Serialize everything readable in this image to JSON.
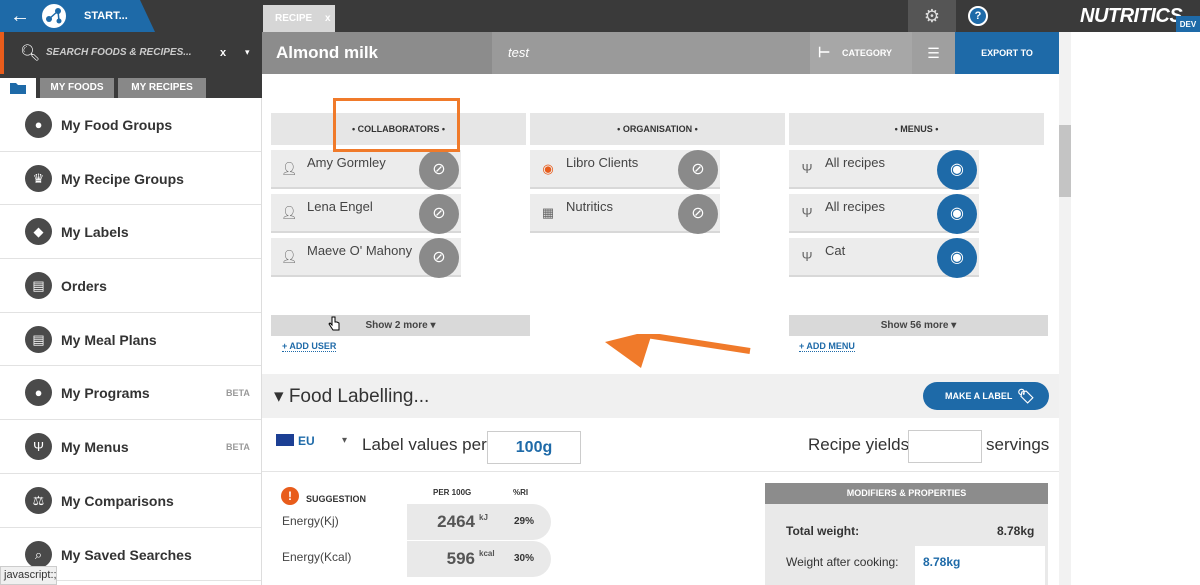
{
  "topbar": {
    "start_label": "START...",
    "tab_label": "RECIPE",
    "tab_close": "x",
    "brand": "NUTRITICS",
    "brand_badge": "DEV",
    "help_label": "?"
  },
  "sidebar": {
    "search_placeholder": "SEARCH FOODS & RECIPES...",
    "search_clear": "x",
    "search_dropdown": "▾",
    "tabs": [
      "MY FOODS",
      "MY RECIPES"
    ],
    "items": [
      {
        "label": "My Food Groups",
        "icon": "apple-icon",
        "badge": ""
      },
      {
        "label": "My Recipe Groups",
        "icon": "chef-hat-icon",
        "badge": ""
      },
      {
        "label": "My Labels",
        "icon": "tag-icon",
        "badge": ""
      },
      {
        "label": "Orders",
        "icon": "document-icon",
        "badge": ""
      },
      {
        "label": "My Meal Plans",
        "icon": "document-icon",
        "badge": ""
      },
      {
        "label": "My Programs",
        "icon": "apple-icon",
        "badge": "BETA"
      },
      {
        "label": "My Menus",
        "icon": "cutlery-icon",
        "badge": "BETA"
      },
      {
        "label": "My Comparisons",
        "icon": "scales-icon",
        "badge": ""
      },
      {
        "label": "My Saved Searches",
        "icon": "search-icon",
        "badge": ""
      }
    ]
  },
  "status_bar": "javascript:;",
  "recipe": {
    "title": "Almond milk",
    "subtitle": "test",
    "category_label": "CATEGORY",
    "export_label": "EXPORT TO"
  },
  "sharing": {
    "collaborators": {
      "header": "COLLABORATORS",
      "rows": [
        "Amy Gormley",
        "Lena Engel",
        "Maeve O' Mahony"
      ],
      "more": "Show 2 more",
      "add": "+ ADD USER"
    },
    "organisation": {
      "header": "ORGANISATION",
      "rows": [
        "Libro Clients",
        "Nutritics"
      ]
    },
    "menus": {
      "header": "MENUS",
      "rows": [
        "All recipes",
        "All recipes",
        "Cat"
      ],
      "more": "Show 56 more",
      "add": "+ ADD MENU"
    }
  },
  "food_labelling": {
    "title": "Food Labelling...",
    "make_label": "MAKE A LABEL",
    "region": "EU",
    "label_values_per": "Label values per",
    "per_value": "100g",
    "recipe_yields": "Recipe yields",
    "servings": "servings",
    "suggestion": "SUGGESTION",
    "col_per100": "PER 100G",
    "col_ri": "%RI",
    "nutrients": [
      {
        "name": "Energy(Kj)",
        "value": "2464",
        "unit": "kJ",
        "ri": "29%"
      },
      {
        "name": "Energy(Kcal)",
        "value": "596",
        "unit": "kcal",
        "ri": "30%"
      }
    ]
  },
  "modifiers": {
    "header": "MODIFIERS & PROPERTIES",
    "total_weight_label": "Total weight:",
    "total_weight_value": "8.78kg",
    "weight_after_label": "Weight after cooking:",
    "weight_after_value": "8.78kg"
  },
  "colors": {
    "accent": "#1e6aa8",
    "highlight": "#f07a2a",
    "dark": "#3a3a3a"
  }
}
